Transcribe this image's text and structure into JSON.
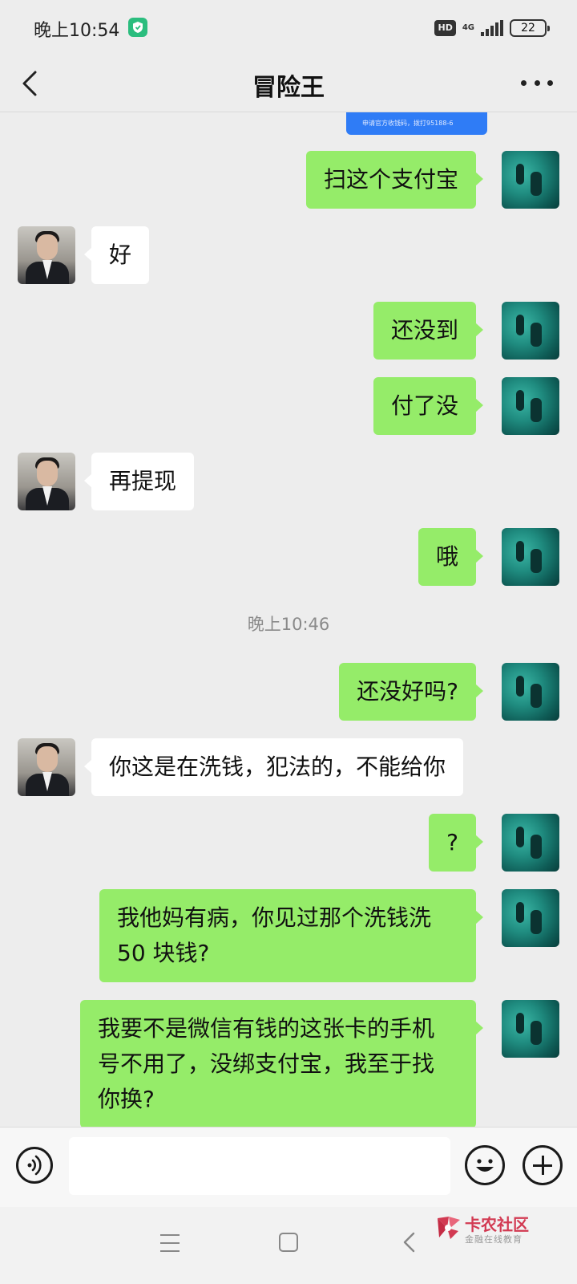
{
  "status_bar": {
    "time": "晚上10:54",
    "hd": "HD",
    "network": "4G",
    "battery": "22",
    "shield_icon": "shield-icon",
    "accent_color": "#2bbd7e"
  },
  "header": {
    "title": "冒险王",
    "back_icon": "chevron-left-icon",
    "more_icon": "more-dots-icon"
  },
  "chat": {
    "qr_card_caption": "申请官方收钱码，拨打95188-6",
    "messages": [
      {
        "from": "me",
        "text": "扫这个支付宝"
      },
      {
        "from": "them",
        "text": "好"
      },
      {
        "from": "me",
        "text": "还没到"
      },
      {
        "from": "me",
        "text": "付了没"
      },
      {
        "from": "them",
        "text": "再提现"
      },
      {
        "from": "me",
        "text": "哦"
      },
      {
        "type": "time",
        "text": "晚上10:46"
      },
      {
        "from": "me",
        "text": "还没好吗?"
      },
      {
        "from": "them",
        "text": "你这是在洗钱，犯法的，不能给你"
      },
      {
        "from": "me",
        "text": "?"
      },
      {
        "from": "me",
        "line1": "我他妈有病，你见过那个洗钱洗",
        "line2": "50 块钱?"
      },
      {
        "from": "me",
        "line1": "我要不是微信有钱的这张卡的手机",
        "line2": "号不用了，没绑支付宝，我至于找",
        "line3": "你换?"
      }
    ],
    "colors": {
      "my_bubble": "#95ec69",
      "their_bubble": "#ffffff",
      "background": "#ededed"
    }
  },
  "input_bar": {
    "value": "",
    "voice_icon": "voice-icon",
    "emoji_icon": "emoji-icon",
    "plus_icon": "plus-icon"
  },
  "system_nav": {
    "menu_icon": "menu-icon",
    "home_icon": "home-icon",
    "back_icon": "back-icon"
  },
  "watermark": {
    "title": "卡农社区",
    "subtitle": "金融在线教育",
    "brand_color": "#d23a52"
  }
}
